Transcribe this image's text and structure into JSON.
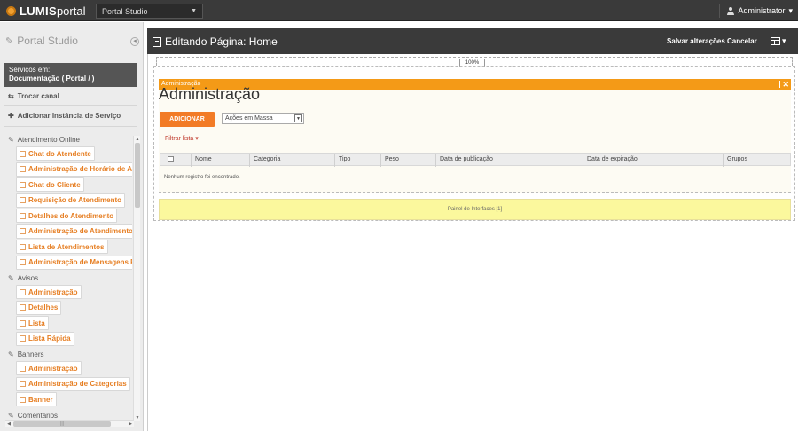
{
  "topbar": {
    "logo_text": "LUMISportal",
    "logo_part1": "LUMIS",
    "logo_part2": "portal",
    "portal_select": "Portal Studio",
    "user_label": "Administrator",
    "user_caret": "▾"
  },
  "sidebar": {
    "title": "Portal Studio",
    "service_prefix": "Serviços em:",
    "service_value": "Documentação ( Portal / )",
    "switch_channel": "Trocar canal",
    "add_service_instance": "Adicionar Instância de Serviço",
    "groups": [
      {
        "label": "Atendimento Online",
        "items": [
          "Chat do Atendente",
          "Administração de Horário de Atendimento",
          "Chat do Cliente",
          "Requisição de Atendimento",
          "Detalhes do Atendimento",
          "Administração de Atendimentos",
          "Lista de Atendimentos",
          "Administração de Mensagens Padrão"
        ]
      },
      {
        "label": "Avisos",
        "items": [
          "Administração",
          "Detalhes",
          "Lista",
          "Lista Rápida"
        ]
      },
      {
        "label": "Banners",
        "items": [
          "Administração",
          "Administração de Categorias",
          "Banner"
        ]
      },
      {
        "label": "Comentários",
        "items": []
      }
    ]
  },
  "main": {
    "header_title": "Editando Página: Home",
    "save_changes": "Salvar alterações",
    "cancel": "Cancelar",
    "zoom": "100%",
    "portlet_bar_label": "Administração",
    "portlet_close": "✕",
    "portlet_title": "Administração",
    "add_button": "ADICIONAR",
    "mass_actions": "Ações em Massa",
    "filter_list": "Filtrar lista",
    "columns": [
      "Nome",
      "Categoria",
      "Tipo",
      "Peso",
      "Data de publicação",
      "Data de expiração",
      "Grupos"
    ],
    "empty_message": "Nenhum registro foi encontrado.",
    "interfaces_panel": "Painel de Interfaces [1]"
  },
  "colors": {
    "topbar": "#3a3a3a",
    "accent_orange": "#f49a17",
    "add_button": "#f27b26",
    "panel_yellow": "#fbf89d"
  }
}
